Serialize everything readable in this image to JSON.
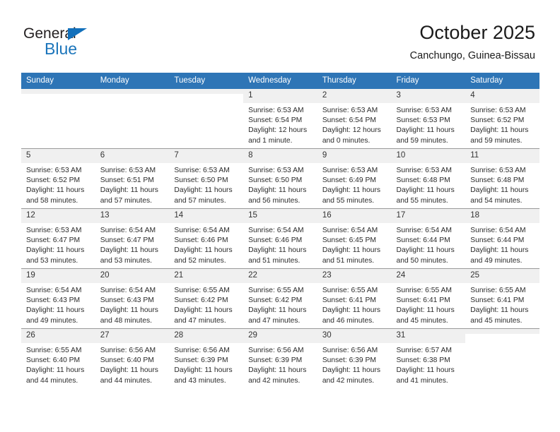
{
  "logo": {
    "text_primary": "General",
    "text_secondary": "Blue",
    "accent_color": "#1b75bb",
    "triangle_icon": "triangle-icon"
  },
  "header": {
    "title": "October 2025",
    "subtitle": "Canchungo, Guinea-Bissau"
  },
  "theme": {
    "header_row_bg": "#2e75b6",
    "daynum_bg": "#f0f0f0",
    "text_color": "#2b2b2b"
  },
  "weekday_headers": [
    "Sunday",
    "Monday",
    "Tuesday",
    "Wednesday",
    "Thursday",
    "Friday",
    "Saturday"
  ],
  "weeks": [
    [
      {
        "day": "",
        "blank": true,
        "sunrise": "",
        "sunset": "",
        "daylight1": "",
        "daylight2": ""
      },
      {
        "day": "",
        "blank": true,
        "sunrise": "",
        "sunset": "",
        "daylight1": "",
        "daylight2": ""
      },
      {
        "day": "",
        "blank": true,
        "sunrise": "",
        "sunset": "",
        "daylight1": "",
        "daylight2": ""
      },
      {
        "day": "1",
        "blank": false,
        "sunrise": "Sunrise: 6:53 AM",
        "sunset": "Sunset: 6:54 PM",
        "daylight1": "Daylight: 12 hours",
        "daylight2": "and 1 minute."
      },
      {
        "day": "2",
        "blank": false,
        "sunrise": "Sunrise: 6:53 AM",
        "sunset": "Sunset: 6:54 PM",
        "daylight1": "Daylight: 12 hours",
        "daylight2": "and 0 minutes."
      },
      {
        "day": "3",
        "blank": false,
        "sunrise": "Sunrise: 6:53 AM",
        "sunset": "Sunset: 6:53 PM",
        "daylight1": "Daylight: 11 hours",
        "daylight2": "and 59 minutes."
      },
      {
        "day": "4",
        "blank": false,
        "sunrise": "Sunrise: 6:53 AM",
        "sunset": "Sunset: 6:52 PM",
        "daylight1": "Daylight: 11 hours",
        "daylight2": "and 59 minutes."
      }
    ],
    [
      {
        "day": "5",
        "blank": false,
        "sunrise": "Sunrise: 6:53 AM",
        "sunset": "Sunset: 6:52 PM",
        "daylight1": "Daylight: 11 hours",
        "daylight2": "and 58 minutes."
      },
      {
        "day": "6",
        "blank": false,
        "sunrise": "Sunrise: 6:53 AM",
        "sunset": "Sunset: 6:51 PM",
        "daylight1": "Daylight: 11 hours",
        "daylight2": "and 57 minutes."
      },
      {
        "day": "7",
        "blank": false,
        "sunrise": "Sunrise: 6:53 AM",
        "sunset": "Sunset: 6:50 PM",
        "daylight1": "Daylight: 11 hours",
        "daylight2": "and 57 minutes."
      },
      {
        "day": "8",
        "blank": false,
        "sunrise": "Sunrise: 6:53 AM",
        "sunset": "Sunset: 6:50 PM",
        "daylight1": "Daylight: 11 hours",
        "daylight2": "and 56 minutes."
      },
      {
        "day": "9",
        "blank": false,
        "sunrise": "Sunrise: 6:53 AM",
        "sunset": "Sunset: 6:49 PM",
        "daylight1": "Daylight: 11 hours",
        "daylight2": "and 55 minutes."
      },
      {
        "day": "10",
        "blank": false,
        "sunrise": "Sunrise: 6:53 AM",
        "sunset": "Sunset: 6:48 PM",
        "daylight1": "Daylight: 11 hours",
        "daylight2": "and 55 minutes."
      },
      {
        "day": "11",
        "blank": false,
        "sunrise": "Sunrise: 6:53 AM",
        "sunset": "Sunset: 6:48 PM",
        "daylight1": "Daylight: 11 hours",
        "daylight2": "and 54 minutes."
      }
    ],
    [
      {
        "day": "12",
        "blank": false,
        "sunrise": "Sunrise: 6:53 AM",
        "sunset": "Sunset: 6:47 PM",
        "daylight1": "Daylight: 11 hours",
        "daylight2": "and 53 minutes."
      },
      {
        "day": "13",
        "blank": false,
        "sunrise": "Sunrise: 6:54 AM",
        "sunset": "Sunset: 6:47 PM",
        "daylight1": "Daylight: 11 hours",
        "daylight2": "and 53 minutes."
      },
      {
        "day": "14",
        "blank": false,
        "sunrise": "Sunrise: 6:54 AM",
        "sunset": "Sunset: 6:46 PM",
        "daylight1": "Daylight: 11 hours",
        "daylight2": "and 52 minutes."
      },
      {
        "day": "15",
        "blank": false,
        "sunrise": "Sunrise: 6:54 AM",
        "sunset": "Sunset: 6:46 PM",
        "daylight1": "Daylight: 11 hours",
        "daylight2": "and 51 minutes."
      },
      {
        "day": "16",
        "blank": false,
        "sunrise": "Sunrise: 6:54 AM",
        "sunset": "Sunset: 6:45 PM",
        "daylight1": "Daylight: 11 hours",
        "daylight2": "and 51 minutes."
      },
      {
        "day": "17",
        "blank": false,
        "sunrise": "Sunrise: 6:54 AM",
        "sunset": "Sunset: 6:44 PM",
        "daylight1": "Daylight: 11 hours",
        "daylight2": "and 50 minutes."
      },
      {
        "day": "18",
        "blank": false,
        "sunrise": "Sunrise: 6:54 AM",
        "sunset": "Sunset: 6:44 PM",
        "daylight1": "Daylight: 11 hours",
        "daylight2": "and 49 minutes."
      }
    ],
    [
      {
        "day": "19",
        "blank": false,
        "sunrise": "Sunrise: 6:54 AM",
        "sunset": "Sunset: 6:43 PM",
        "daylight1": "Daylight: 11 hours",
        "daylight2": "and 49 minutes."
      },
      {
        "day": "20",
        "blank": false,
        "sunrise": "Sunrise: 6:54 AM",
        "sunset": "Sunset: 6:43 PM",
        "daylight1": "Daylight: 11 hours",
        "daylight2": "and 48 minutes."
      },
      {
        "day": "21",
        "blank": false,
        "sunrise": "Sunrise: 6:55 AM",
        "sunset": "Sunset: 6:42 PM",
        "daylight1": "Daylight: 11 hours",
        "daylight2": "and 47 minutes."
      },
      {
        "day": "22",
        "blank": false,
        "sunrise": "Sunrise: 6:55 AM",
        "sunset": "Sunset: 6:42 PM",
        "daylight1": "Daylight: 11 hours",
        "daylight2": "and 47 minutes."
      },
      {
        "day": "23",
        "blank": false,
        "sunrise": "Sunrise: 6:55 AM",
        "sunset": "Sunset: 6:41 PM",
        "daylight1": "Daylight: 11 hours",
        "daylight2": "and 46 minutes."
      },
      {
        "day": "24",
        "blank": false,
        "sunrise": "Sunrise: 6:55 AM",
        "sunset": "Sunset: 6:41 PM",
        "daylight1": "Daylight: 11 hours",
        "daylight2": "and 45 minutes."
      },
      {
        "day": "25",
        "blank": false,
        "sunrise": "Sunrise: 6:55 AM",
        "sunset": "Sunset: 6:41 PM",
        "daylight1": "Daylight: 11 hours",
        "daylight2": "and 45 minutes."
      }
    ],
    [
      {
        "day": "26",
        "blank": false,
        "sunrise": "Sunrise: 6:55 AM",
        "sunset": "Sunset: 6:40 PM",
        "daylight1": "Daylight: 11 hours",
        "daylight2": "and 44 minutes."
      },
      {
        "day": "27",
        "blank": false,
        "sunrise": "Sunrise: 6:56 AM",
        "sunset": "Sunset: 6:40 PM",
        "daylight1": "Daylight: 11 hours",
        "daylight2": "and 44 minutes."
      },
      {
        "day": "28",
        "blank": false,
        "sunrise": "Sunrise: 6:56 AM",
        "sunset": "Sunset: 6:39 PM",
        "daylight1": "Daylight: 11 hours",
        "daylight2": "and 43 minutes."
      },
      {
        "day": "29",
        "blank": false,
        "sunrise": "Sunrise: 6:56 AM",
        "sunset": "Sunset: 6:39 PM",
        "daylight1": "Daylight: 11 hours",
        "daylight2": "and 42 minutes."
      },
      {
        "day": "30",
        "blank": false,
        "sunrise": "Sunrise: 6:56 AM",
        "sunset": "Sunset: 6:39 PM",
        "daylight1": "Daylight: 11 hours",
        "daylight2": "and 42 minutes."
      },
      {
        "day": "31",
        "blank": false,
        "sunrise": "Sunrise: 6:57 AM",
        "sunset": "Sunset: 6:38 PM",
        "daylight1": "Daylight: 11 hours",
        "daylight2": "and 41 minutes."
      },
      {
        "day": "",
        "blank": true,
        "sunrise": "",
        "sunset": "",
        "daylight1": "",
        "daylight2": ""
      }
    ]
  ]
}
